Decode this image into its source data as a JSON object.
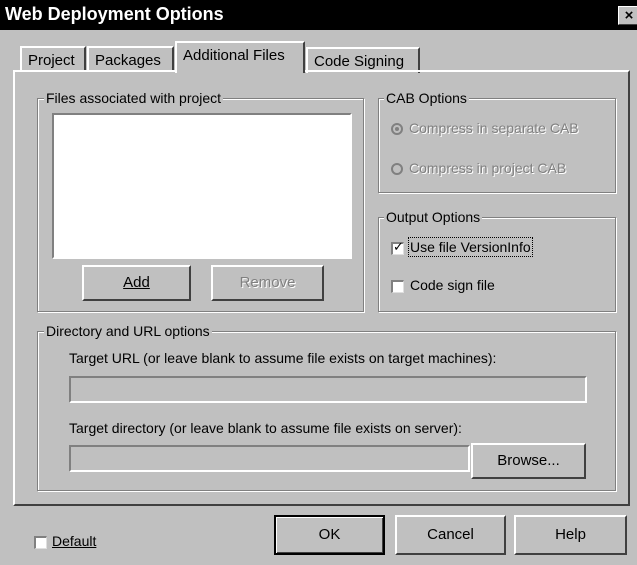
{
  "window": {
    "title": "Web Deployment Options",
    "close_glyph": "×"
  },
  "tabs": [
    {
      "label": "Project"
    },
    {
      "label": "Packages"
    },
    {
      "label": "Additional Files",
      "active": true
    },
    {
      "label": "Code Signing"
    }
  ],
  "files_group": {
    "legend": "Files associated with project",
    "files": [],
    "add_label": "Add",
    "remove_label": "Remove"
  },
  "cab_options": {
    "legend": "CAB Options",
    "separate_label": "Compress in separate CAB",
    "separate_selected": true,
    "project_label": "Compress in project CAB",
    "project_selected": false,
    "enabled": false
  },
  "output_options": {
    "legend": "Output Options",
    "versioninfo_label": "Use file VersionInfo",
    "versioninfo_checked": true,
    "codesign_label": "Code sign file",
    "codesign_checked": false
  },
  "directory_group": {
    "legend": "Directory and URL options",
    "url_label": "Target URL (or leave blank to assume file exists on target machines):",
    "url_value": "",
    "dir_label": "Target directory (or leave blank to assume file exists on server):",
    "dir_value": "",
    "browse_label": "Browse..."
  },
  "footer": {
    "default_label": "Default",
    "default_checked": false,
    "ok_label": "OK",
    "cancel_label": "Cancel",
    "help_label": "Help"
  }
}
